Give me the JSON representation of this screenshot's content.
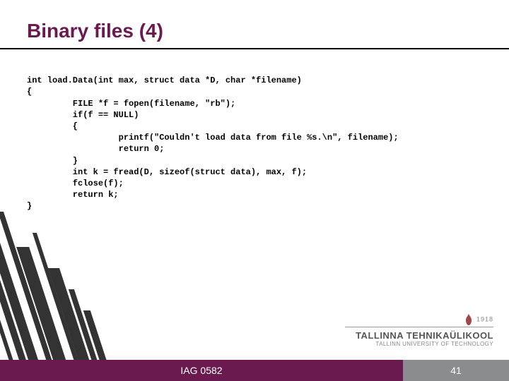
{
  "slide": {
    "title": "Binary files (4)"
  },
  "code": {
    "line0": "int load.Data(int max, struct data *D, char *filename)",
    "line1": "{",
    "line2": "         FILE *f = fopen(filename, \"rb\");",
    "line3": "         if(f == NULL)",
    "line4": "         {",
    "line5": "                  printf(\"Couldn't load data from file %s.\\n\", filename);",
    "line6": "                  return 0;",
    "line7": "         }",
    "line8": "         int k = fread(D, sizeof(struct data), max, f);",
    "line9": "         fclose(f);",
    "line10": "         return k;",
    "line11": "}"
  },
  "logo": {
    "year": "1918",
    "main": "TALLINNA TEHNIKAÜLIKOOL",
    "sub": "TALLINN UNIVERSITY OF TECHNOLOGY"
  },
  "footer": {
    "course": "IAG 0582",
    "page": "41"
  }
}
